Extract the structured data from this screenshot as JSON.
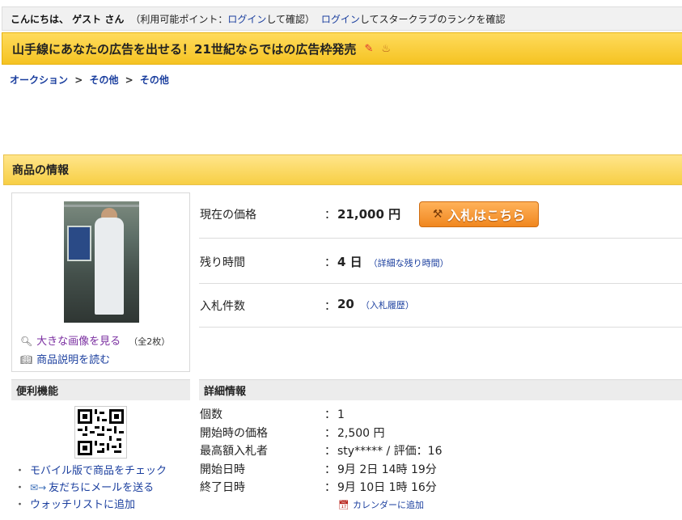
{
  "header": {
    "greeting": "こんにちは、 ゲスト さん",
    "points_prefix": "（利用可能ポイント：",
    "points_login": "ログイン",
    "points_suffix": "して確認）",
    "star_login": "ログイン",
    "star_suffix": "してスタークラブのランクを確認"
  },
  "banner": {
    "text": "山手線にあなたの広告を出せる！21世紀ならではの広告枠発売",
    "icons": [
      "pencil-icon",
      "hot-item-icon"
    ]
  },
  "breadcrumb": [
    "オークション",
    "その他",
    "その他"
  ],
  "breadcrumb_sep": ">",
  "section": {
    "title": "商品の情報"
  },
  "image_panel": {
    "view_large": "大きな画像を見る",
    "image_count": "（全2枚）",
    "read_description": "商品説明を読む"
  },
  "summary": {
    "price_label": "現在の価格",
    "price_value": "21,000 円",
    "bid_button": "入札はこちら",
    "time_label": "残り時間",
    "time_value": "4 日",
    "time_link": "（詳細な残り時間）",
    "bids_label": "入札件数",
    "bids_value": "20",
    "bids_link": "（入札履歴）",
    "colon": "："
  },
  "tools": {
    "title": "便利機能",
    "items": [
      "モバイル版で商品をチェック",
      "友だちにメールを送る",
      "ウォッチリストに追加"
    ],
    "bullet": "・"
  },
  "details": {
    "title": "詳細情報",
    "rows": [
      {
        "label": "個数",
        "value": "1"
      },
      {
        "label": "開始時の価格",
        "value": "2,500 円"
      },
      {
        "label": "最高額入札者",
        "value": "sty***** / 評価：16"
      },
      {
        "label": "開始日時",
        "value": "9月 2日 14時 19分"
      },
      {
        "label": "終了日時",
        "value": "9月 10日 1時 16分"
      }
    ],
    "calendar_link": "カレンダーに追加",
    "colon": "："
  }
}
